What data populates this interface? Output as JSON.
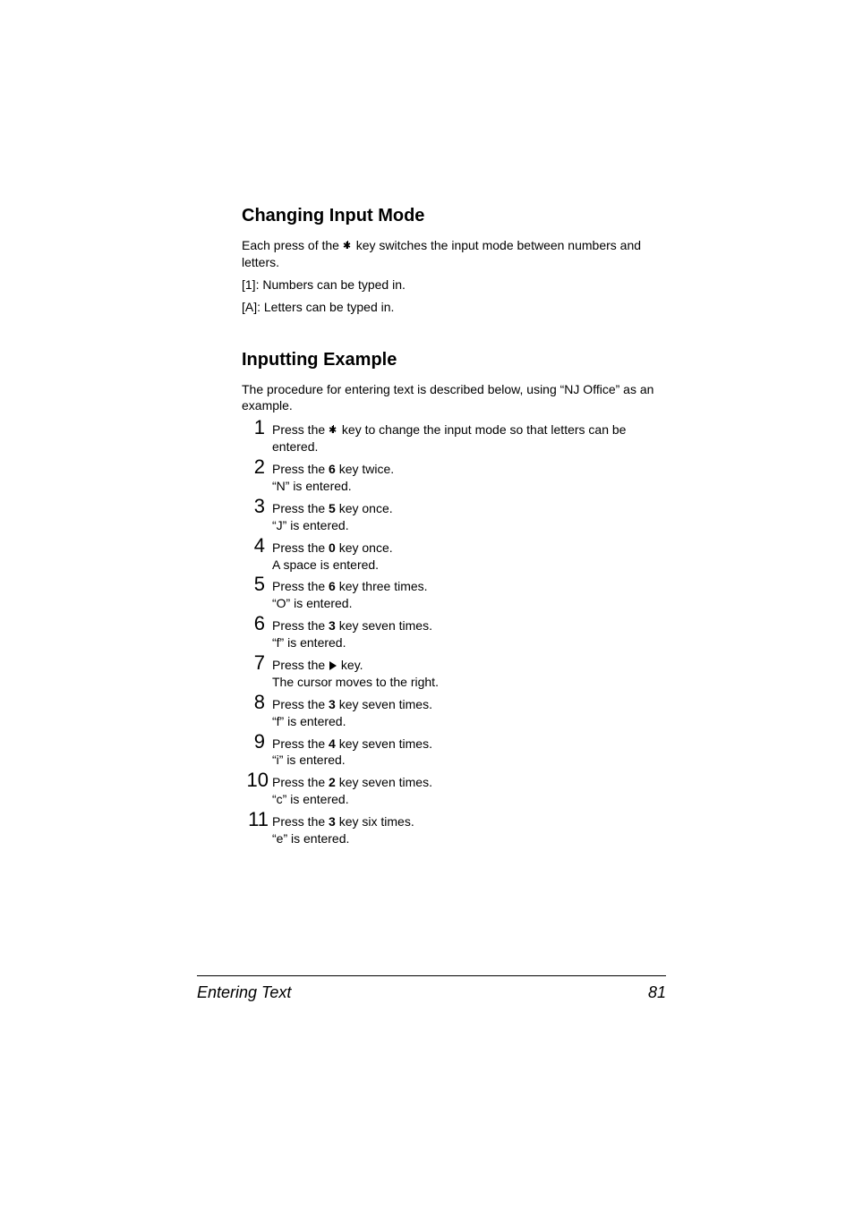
{
  "section1": {
    "heading": "Changing Input Mode",
    "p1_pre": "Each press of the ",
    "p1_post": " key switches the input mode between numbers and letters.",
    "p2": "[1]: Numbers can be typed in.",
    "p3": "[A]: Letters can be typed in."
  },
  "section2": {
    "heading": "Inputting Example",
    "intro": "The procedure for entering text is described below, using “NJ Office” as an example.",
    "steps": {
      "s1": {
        "num": "1",
        "pre": "Press the ",
        "post": " key to change the input mode so that letters can be entered."
      },
      "s2": {
        "num": "2",
        "pre": "Press the ",
        "key": "6",
        "post": " key twice.",
        "result": "“N” is entered."
      },
      "s3": {
        "num": "3",
        "pre": "Press the ",
        "key": "5",
        "post": " key once.",
        "result": "“J” is entered."
      },
      "s4": {
        "num": "4",
        "pre": "Press the ",
        "key": "0",
        "post": " key once.",
        "result": "A space is entered."
      },
      "s5": {
        "num": "5",
        "pre": "Press the ",
        "key": "6",
        "post": " key three times.",
        "result": "“O” is entered."
      },
      "s6": {
        "num": "6",
        "pre": "Press the ",
        "key": "3",
        "post": " key seven times.",
        "result": "“f” is entered."
      },
      "s7": {
        "num": "7",
        "pre": "Press the ",
        "post": " key.",
        "result": "The cursor moves to the right."
      },
      "s8": {
        "num": "8",
        "pre": "Press the ",
        "key": "3",
        "post": " key seven times.",
        "result": "“f” is entered."
      },
      "s9": {
        "num": "9",
        "pre": "Press the ",
        "key": "4",
        "post": " key seven times.",
        "result": "“i” is entered."
      },
      "s10": {
        "num": "10",
        "pre": "Press the ",
        "key": "2",
        "post": " key seven times.",
        "result": "“c” is entered."
      },
      "s11": {
        "num": "11",
        "pre": "Press the ",
        "key": "3",
        "post": " key six times.",
        "result": "“e” is entered."
      }
    }
  },
  "footer": {
    "title": "Entering Text",
    "page": "81"
  }
}
